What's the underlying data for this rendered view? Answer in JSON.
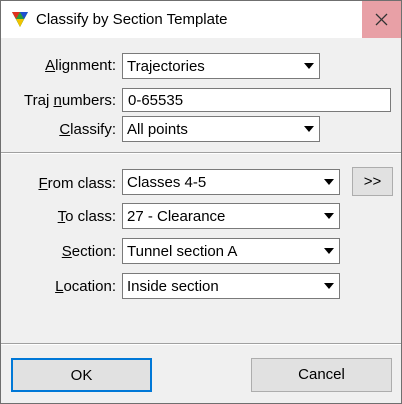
{
  "window": {
    "title": "Classify by Section Template",
    "close_label": "close"
  },
  "alignment": {
    "label_u": "A",
    "label_rest": "lignment:",
    "value": "Trajectories"
  },
  "traj_numbers": {
    "label_pre": "Traj ",
    "label_u": "n",
    "label_rest": "umbers:",
    "value": "0-65535"
  },
  "classify": {
    "label_u": "C",
    "label_rest": "lassify:",
    "value": "All points"
  },
  "from_class": {
    "label_u": "F",
    "label_rest": "rom class:",
    "value": "Classes 4-5"
  },
  "more_button": {
    "label": ">>"
  },
  "to_class": {
    "label_u": "T",
    "label_rest": "o class:",
    "value": "27 - Clearance"
  },
  "section": {
    "label_u": "S",
    "label_rest": "ection:",
    "value": "Tunnel section A"
  },
  "location": {
    "label_u": "L",
    "label_rest": "ocation:",
    "value": "Inside section"
  },
  "buttons": {
    "ok": "OK",
    "cancel": "Cancel"
  },
  "colors": {
    "close_hover": "#e8a0a6",
    "dialog_bg": "#f0f0f0"
  }
}
